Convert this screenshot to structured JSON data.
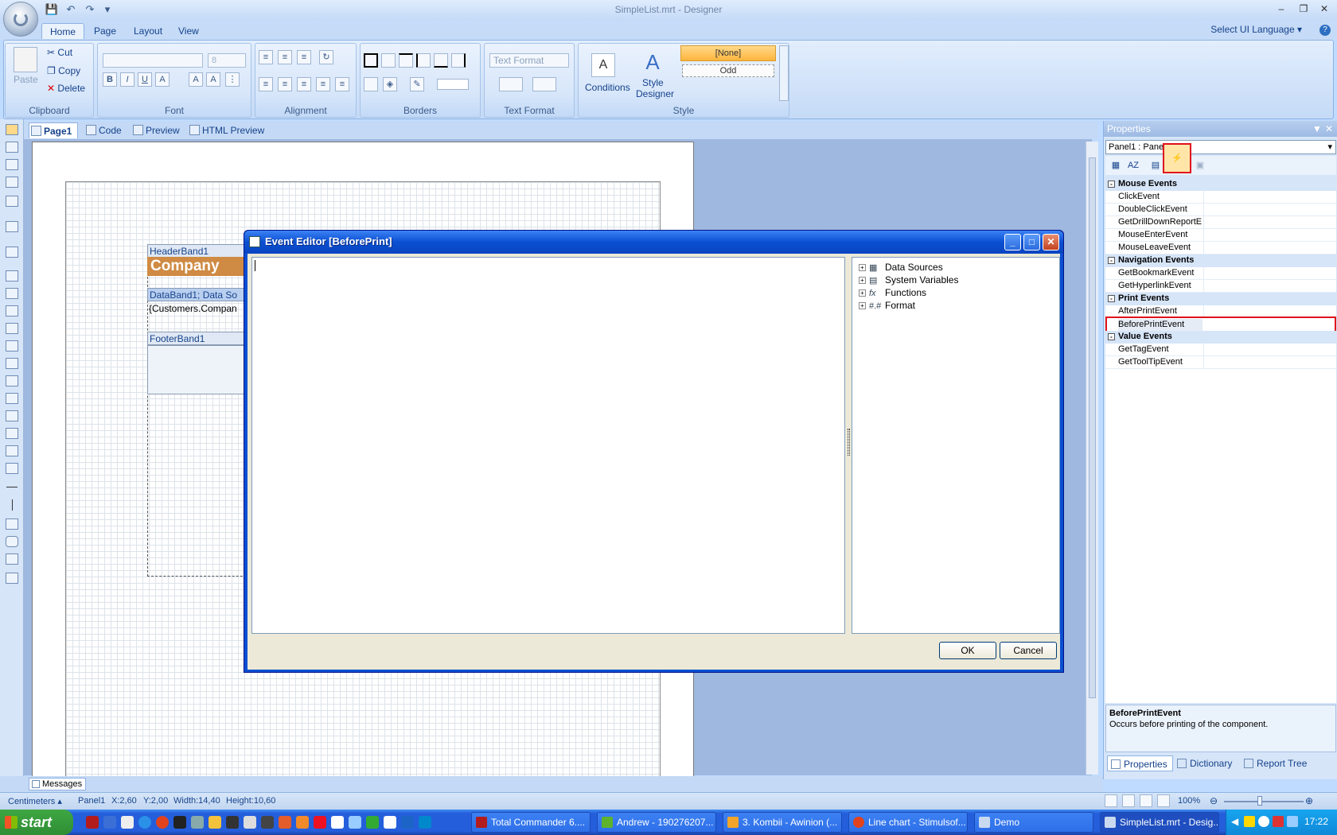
{
  "window": {
    "title": "SimpleList.mrt - Designer"
  },
  "ribbon": {
    "tabs": [
      "Home",
      "Page",
      "Layout",
      "View"
    ],
    "ui_language": "Select UI Language",
    "clipboard": {
      "paste": "Paste",
      "cut": "Cut",
      "copy": "Copy",
      "delete": "Delete",
      "label": "Clipboard"
    },
    "font": {
      "size": "8",
      "label": "Font",
      "bold": "B",
      "italic": "I",
      "underline": "U"
    },
    "alignment": {
      "label": "Alignment"
    },
    "borders": {
      "label": "Borders"
    },
    "text_format": {
      "value": "Text Format",
      "label": "Text Format"
    },
    "style": {
      "conditions": "Conditions",
      "style_designer_1": "Style",
      "style_designer_2": "Designer",
      "none": "[None]",
      "odd": "Odd",
      "label": "Style"
    }
  },
  "doc_tabs": [
    "Page1",
    "Code",
    "Preview",
    "HTML Preview"
  ],
  "report": {
    "header_band": "HeaderBand1",
    "company": "Company",
    "data_band": "DataBand1; Data So",
    "customers": "{Customers.Compan",
    "footer_band": "FooterBand1"
  },
  "dialog": {
    "title": "Event Editor [BeforePrint]",
    "tree": [
      "Data Sources",
      "System Variables",
      "Functions",
      "Format"
    ],
    "ok": "OK",
    "cancel": "Cancel"
  },
  "properties": {
    "header": "Properties",
    "selected": "Panel1 : Panel",
    "categories": [
      {
        "name": "Mouse Events",
        "items": [
          "ClickEvent",
          "DoubleClickEvent",
          "GetDrillDownReportE",
          "MouseEnterEvent",
          "MouseLeaveEvent"
        ]
      },
      {
        "name": "Navigation Events",
        "items": [
          "GetBookmarkEvent",
          "GetHyperlinkEvent"
        ]
      },
      {
        "name": "Print Events",
        "items": [
          "AfterPrintEvent",
          "BeforePrintEvent"
        ]
      },
      {
        "name": "Value Events",
        "items": [
          "GetTagEvent",
          "GetToolTipEvent"
        ]
      }
    ],
    "desc_title": "BeforePrintEvent",
    "desc_text": "Occurs before printing of the component.",
    "bottom_tabs": [
      "Properties",
      "Dictionary",
      "Report Tree"
    ]
  },
  "messages": "Messages",
  "status": {
    "units": "Centimeters",
    "component": "Panel1",
    "x": "X:2,60",
    "y": "Y:2,00",
    "width": "Width:14,40",
    "height": "Height:10,60",
    "zoom": "100%"
  },
  "taskbar": {
    "start": "start",
    "buttons": [
      "Total Commander 6....",
      "Andrew - 190276207...",
      "3. Kombii - Awinion (...",
      "Line chart - Stimulsof...",
      "Demo",
      "SimpleList.mrt - Desig..."
    ],
    "clock": "17:22"
  }
}
